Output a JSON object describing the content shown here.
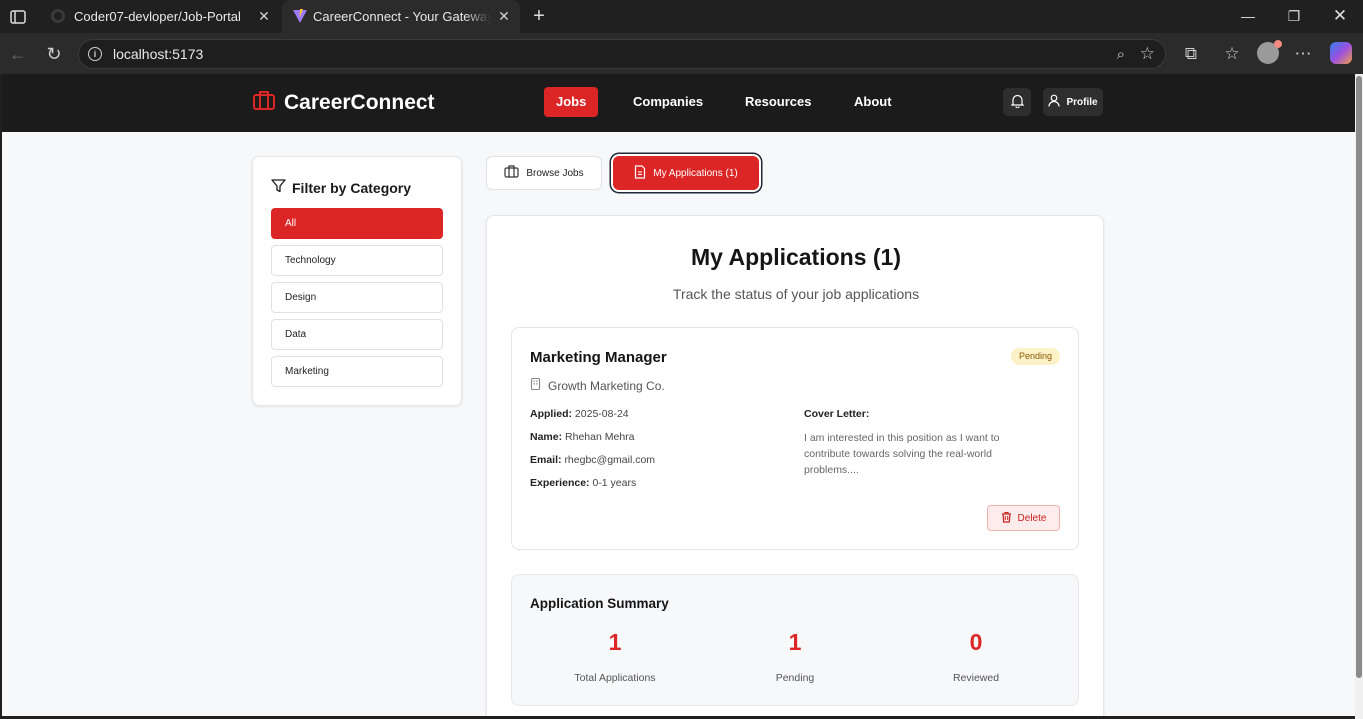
{
  "browser": {
    "tabs": [
      {
        "title": "Coder07-devloper/Job-Portal"
      },
      {
        "title": "CareerConnect - Your Gateway to"
      }
    ],
    "url": "localhost:5173"
  },
  "header": {
    "brand": "CareerConnect",
    "nav": [
      "Jobs",
      "Companies",
      "Resources",
      "About"
    ],
    "profile_label": "Profile"
  },
  "filter": {
    "title": "Filter by Category",
    "categories": [
      "All",
      "Technology",
      "Design",
      "Data",
      "Marketing"
    ],
    "selected": "All"
  },
  "toggle": {
    "browse_label": "Browse Jobs",
    "apps_label": "My Applications (1)"
  },
  "applications": {
    "title": "My Applications (1)",
    "subtitle": "Track the status of your job applications",
    "items": [
      {
        "job_title": "Marketing Manager",
        "status": "Pending",
        "company": "Growth Marketing Co.",
        "applied_label": "Applied:",
        "applied": "2025-08-24",
        "name_label": "Name:",
        "name": "Rhehan Mehra",
        "email_label": "Email:",
        "email": "rhegbc@gmail.com",
        "experience_label": "Experience:",
        "experience": "0-1 years",
        "cover_letter_label": "Cover Letter:",
        "cover_letter": "I am interested in this position as I want to contribute towards solving the real-world problems....",
        "delete_label": "Delete"
      }
    ]
  },
  "summary": {
    "title": "Application Summary",
    "stats": [
      {
        "value": "1",
        "label": "Total Applications"
      },
      {
        "value": "1",
        "label": "Pending"
      },
      {
        "value": "0",
        "label": "Reviewed"
      }
    ]
  },
  "colors": {
    "accent": "#dc2626",
    "header_bg": "#1b1b1b",
    "pending_badge_bg": "#fdf1c7"
  }
}
